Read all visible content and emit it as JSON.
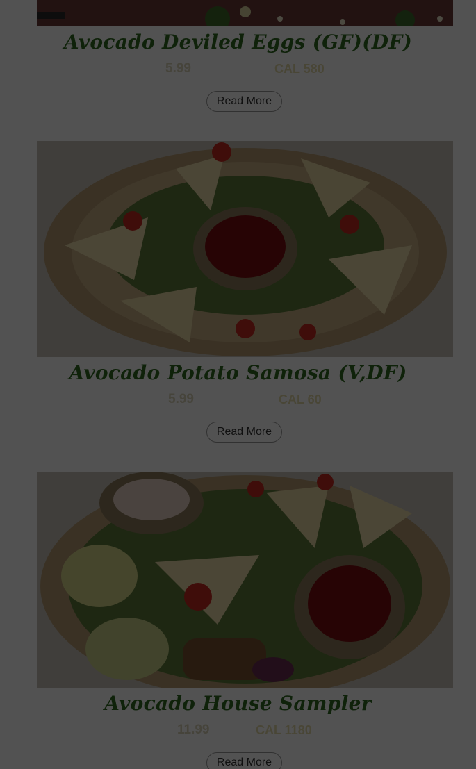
{
  "menu": {
    "items": [
      {
        "title": "Avocado Deviled Eggs (GF)(DF)",
        "price": "5.99",
        "calories": "CAL 580",
        "read_more": "Read More",
        "photo_icon": "deviled-eggs-photo"
      },
      {
        "title": "Avocado Potato Samosa (V,DF)",
        "price": "5.99",
        "calories": "CAL 60",
        "read_more": "Read More",
        "photo_icon": "samosa-photo"
      },
      {
        "title": "Avocado House Sampler",
        "price": "11.99",
        "calories": "CAL 1180",
        "read_more": "Read More",
        "photo_icon": "sampler-photo"
      }
    ]
  },
  "colors": {
    "title_green": "#2f6a1f",
    "overlay": "rgba(0,0,0,0.68)",
    "sauce_red": "#8a1212"
  }
}
